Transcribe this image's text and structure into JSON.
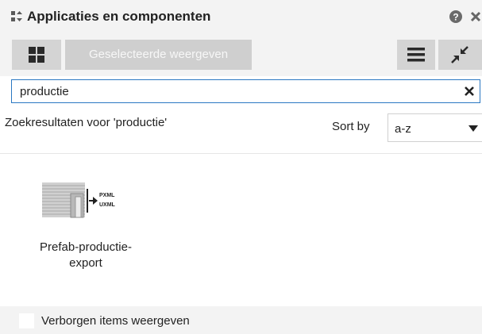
{
  "window": {
    "title": "Applicaties en componenten",
    "help_icon": "help-icon",
    "close_icon": "close-icon"
  },
  "toolbar": {
    "grid_view_icon": "grid-icon",
    "selected_view_label": "Geselecteerde weergeven",
    "list_view_icon": "list-icon",
    "collapse_icon": "collapse-icon"
  },
  "search": {
    "value": "productie",
    "clear_icon": "close-icon"
  },
  "results": {
    "label": "Zoekresultaten voor 'productie'",
    "sort_label": "Sort by",
    "sort_value": "a-z"
  },
  "items": [
    {
      "name_line1": "Prefab-productie-",
      "name_line2": "export",
      "icon": "export-pxml-uxml-icon",
      "icon_text1": "PXML",
      "icon_text2": "UXML"
    }
  ],
  "footer": {
    "checkbox_label": "Verborgen items weergeven",
    "checked": false
  },
  "colors": {
    "panel_bg": "#f3f3f3",
    "button_bg": "#d4d4d4",
    "accent": "#2a78c2"
  }
}
